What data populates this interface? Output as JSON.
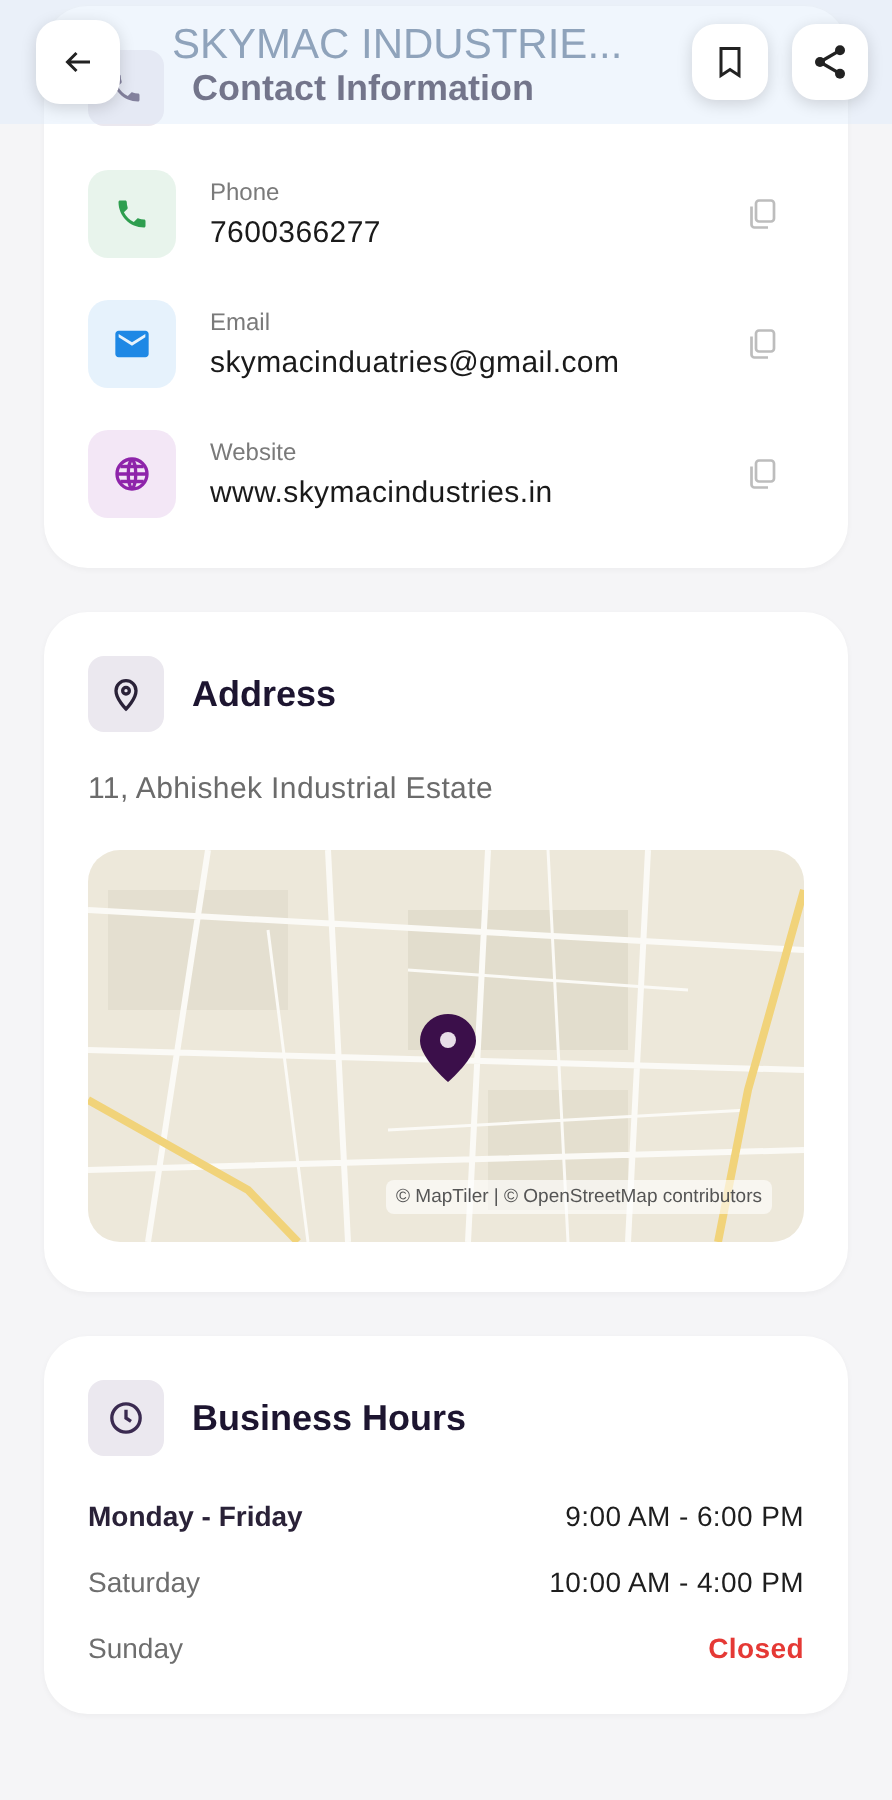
{
  "header": {
    "title": "SKYMAC INDUSTRIE..."
  },
  "contact": {
    "title": "Contact Information",
    "items": [
      {
        "kind": "phone",
        "label": "Phone",
        "value": "7600366277",
        "color": "#2e9e4f"
      },
      {
        "kind": "email",
        "label": "Email",
        "value": "skymacinduatries@gmail.com",
        "color": "#1e88e5"
      },
      {
        "kind": "web",
        "label": "Website",
        "value": "www.skymacindustries.in",
        "color": "#8e24aa"
      }
    ]
  },
  "address": {
    "title": "Address",
    "line": "11, Abhishek Industrial Estate",
    "map": {
      "kind": "picture",
      "attribution": "© MapTiler | © OpenStreetMap contributors"
    }
  },
  "hours": {
    "title": "Business Hours",
    "rows": [
      {
        "day": "Monday - Friday",
        "time": "9:00 AM - 6:00 PM",
        "current": true,
        "closed": false
      },
      {
        "day": "Saturday",
        "time": "10:00 AM - 4:00 PM",
        "current": false,
        "closed": false
      },
      {
        "day": "Sunday",
        "time": "Closed",
        "current": false,
        "closed": true
      }
    ]
  }
}
